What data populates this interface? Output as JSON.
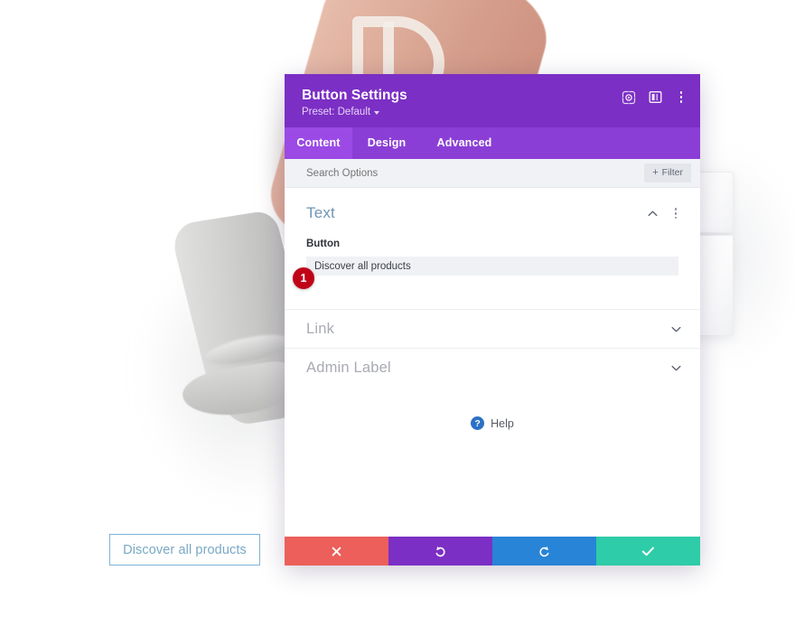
{
  "page": {
    "cta_button_label": "Discover all products"
  },
  "modal": {
    "title": "Button Settings",
    "preset_label": "Preset: Default",
    "header_icons": [
      {
        "name": "target-icon"
      },
      {
        "name": "layout-panel-icon"
      },
      {
        "name": "more-vertical-icon"
      }
    ],
    "tabs": [
      {
        "label": "Content",
        "active": true
      },
      {
        "label": "Design",
        "active": false
      },
      {
        "label": "Advanced",
        "active": false
      }
    ],
    "search": {
      "placeholder": "Search Options",
      "value": ""
    },
    "filter_button": {
      "label": "Filter",
      "plus": "+"
    },
    "sections": [
      {
        "title": "Text",
        "state": "expanded",
        "field_label": "Button",
        "field_value": "Discover all products",
        "step_badge": "1"
      },
      {
        "title": "Link",
        "state": "collapsed"
      },
      {
        "title": "Admin Label",
        "state": "collapsed"
      }
    ],
    "help": {
      "label": "Help",
      "glyph": "?"
    },
    "actions": [
      {
        "name": "cancel-button",
        "icon": "close-icon",
        "color": "#ec5f5a"
      },
      {
        "name": "undo-button",
        "icon": "undo-icon",
        "color": "#7b2fc4"
      },
      {
        "name": "redo-button",
        "icon": "redo-icon",
        "color": "#2884d6"
      },
      {
        "name": "save-button",
        "icon": "checkmark-icon",
        "color": "#2ecca8"
      }
    ]
  },
  "colors": {
    "header_purple": "#7b2fc4",
    "tabbar_purple": "#8b3ed6",
    "active_tab_purple": "#9b4ae6",
    "section_title_blue": "#6f96b5",
    "badge_red": "#c00418",
    "help_blue": "#2b71c6",
    "cta_border_blue": "#7fb3d5"
  }
}
